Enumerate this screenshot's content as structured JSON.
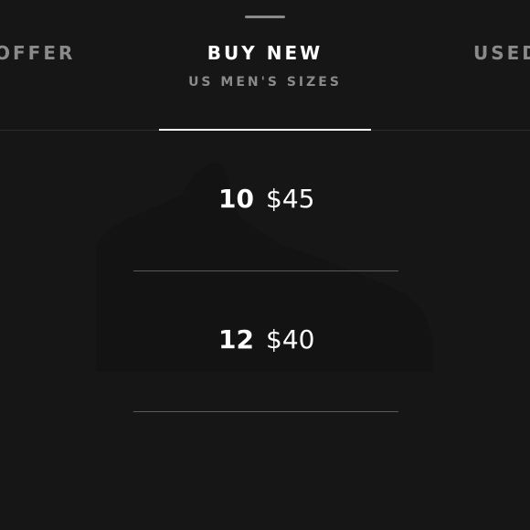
{
  "tabs": {
    "left_label": "OFFER",
    "center_label": "BUY NEW",
    "center_subtitle": "US MEN'S SIZES",
    "right_label": "USED"
  },
  "listings": [
    {
      "size": "10",
      "price": "$45"
    },
    {
      "size": "12",
      "price": "$40"
    }
  ],
  "colors": {
    "background": "#161616",
    "inactive_text": "#8a8a8a",
    "active_text": "#ffffff",
    "divider": "#5a5a5a"
  }
}
